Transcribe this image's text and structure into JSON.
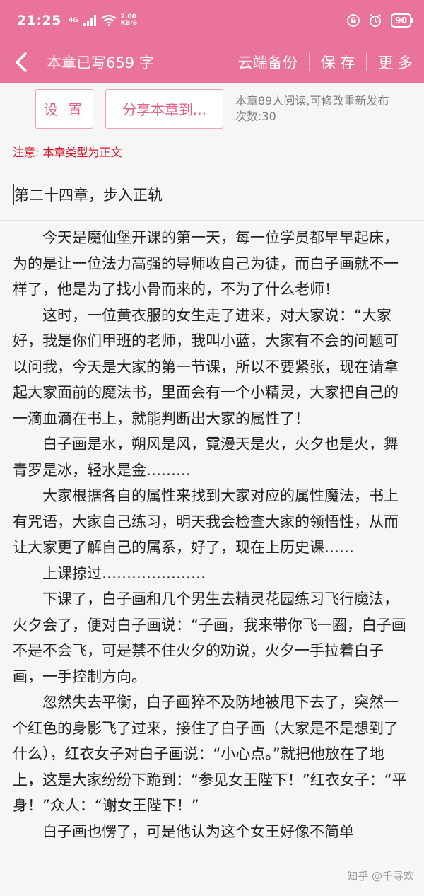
{
  "status_bar": {
    "time": "21:25",
    "net_type": "4G",
    "speed_value": "2.00",
    "speed_unit": "KB/S",
    "battery": "90"
  },
  "navbar": {
    "title": "本章已写659 字",
    "actions": [
      "云端备份",
      "保 存",
      "更 多"
    ]
  },
  "toolbar": {
    "settings_label": "设 置",
    "share_label": "分享本章到...",
    "read_info": "本章89人阅读,可修改重新发布次数:30"
  },
  "notice": "注意: 本章类型为正文",
  "chapter_title": "第二十四章，步入正轨",
  "paragraphs": [
    "今天是魔仙堡开课的第一天，每一位学员都早早起床，为的是让一位法力高强的导师收自己为徒，而白子画就不一样了，他是为了找小骨而来的，不为了什么老师！",
    "这时，一位黄衣服的女生走了进来，对大家说：“大家好，我是你们甲班的老师，我叫小蓝，大家有不会的问题可以问我，今天是大家的第一节课，所以不要紧张，现在请拿起大家面前的魔法书，里面会有一个小精灵，大家把自己的一滴血滴在书上，就能判断出大家的属性了！",
    "白子画是水，朔风是风，霓漫天是火，火夕也是火，舞青罗是冰，轻水是金………",
    "大家根据各自的属性来找到大家对应的属性魔法，书上有咒语，大家自己练习，明天我会检查大家的领悟性，从而让大家更了解自己的属系，好了，现在上历史课……",
    "上课掠过…………………",
    "下课了，白子画和几个男生去精灵花园练习飞行魔法，火夕会了，便对白子画说：“子画，我来带你飞一圈，白子画不是不会飞，可是禁不住火夕的劝说，火夕一手拉着白子画，一手控制方向。",
    "忽然失去平衡，白子画猝不及防地被甩下去了，突然一个红色的身影飞了过来，接住了白子画（大家是不是想到了什么），红衣女子对白子画说：“小心点。”就把他放在了地上，这是大家纷纷下跪到：“参见女王陛下！”红衣女子：“平身！”众人：“谢女王陛下！”",
    "白子画也愣了，可是他认为这个女王好像不简单"
  ],
  "watermark": "知乎 @千寻欢"
}
